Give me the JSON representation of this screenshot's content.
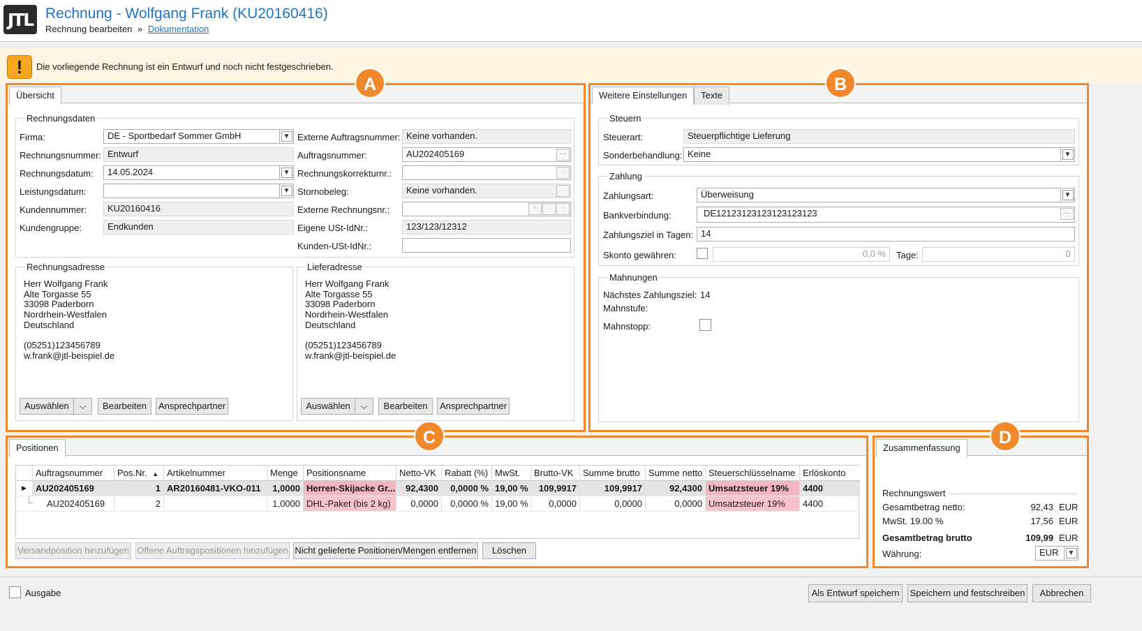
{
  "header": {
    "logo": "JTL",
    "title": "Rechnung - Wolfgang Frank (KU20160416)",
    "breadcrumb_current": "Rechnung bearbeiten",
    "breadcrumb_sep": "»",
    "breadcrumb_link": "Dokumentation"
  },
  "warning": {
    "icon": "!",
    "text": "Die vorliegende Rechnung ist ein Entwurf und noch nicht festgeschrieben."
  },
  "badges": {
    "a": "A",
    "b": "B",
    "c": "C",
    "d": "D"
  },
  "overview": {
    "tab": "Übersicht",
    "group_title": "Rechnungsdaten",
    "left": [
      {
        "label": "Firma:",
        "value": "DE - Sportbedarf Sommer GmbH"
      },
      {
        "label": "Rechnungsnummer:",
        "value": "Entwurf"
      },
      {
        "label": "Rechnungsdatum:",
        "value": "14.05.2024"
      },
      {
        "label": "Leistungsdatum:",
        "value": ""
      },
      {
        "label": "Kundennummer:",
        "value": "KU20160416"
      },
      {
        "label": "Kundengruppe:",
        "value": "Endkunden"
      }
    ],
    "right": [
      {
        "label": "Externe Auftragsnummer:",
        "value": "Keine vorhanden."
      },
      {
        "label": "Auftragsnummer:",
        "value": "AU202405169"
      },
      {
        "label": "Rechnungskorrekturnr.:",
        "value": ""
      },
      {
        "label": "Stornobeleg:",
        "value": "Keine vorhanden."
      },
      {
        "label": "Externe Rechnungsnr.:",
        "value": ""
      },
      {
        "label": "Eigene USt-IdNr.:",
        "value": "123/123/12312"
      },
      {
        "label": "Kunden-USt-IdNr.:",
        "value": ""
      }
    ],
    "ellipsis": "···",
    "plus": "+",
    "minus": "−",
    "billing": {
      "title": "Rechnungsadresse",
      "lines": [
        "Herr Wolfgang Frank",
        "Alte Torgasse 55",
        "33098 Paderborn",
        "Nordrhein-Westfalen",
        "Deutschland"
      ],
      "phone": "(05251)123456789",
      "email": "w.frank@jtl-beispiel.de"
    },
    "shipping": {
      "title": "Lieferadresse",
      "lines": [
        "Herr Wolfgang Frank",
        "Alte Torgasse 55",
        "33098 Paderborn",
        "Nordrhein-Westfalen",
        "Deutschland"
      ],
      "phone": "(05251)123456789",
      "email": "w.frank@jtl-beispiel.de"
    },
    "buttons": {
      "select": "Auswählen",
      "edit": "Bearbeiten",
      "contact": "Ansprechpartner"
    }
  },
  "settings": {
    "tabs": [
      "Weitere Einstellungen",
      "Texte"
    ],
    "taxes": {
      "title": "Steuern",
      "tax_type_label": "Steuerart:",
      "tax_type": "Steuerpflichtige Lieferung",
      "special_label": "Sonderbehandlung:",
      "special": "Keine"
    },
    "payment": {
      "title": "Zahlung",
      "method_label": "Zahlungsart:",
      "method": "Überweisung",
      "bank_label": "Bankverbindung:",
      "bank": "DE12123123123123123123",
      "term_label": "Zahlungsziel in Tagen:",
      "term": "14",
      "discount_label": "Skonto gewähren:",
      "discount_value": "0,0 %",
      "days_label": "Tage:",
      "days_value": "0"
    },
    "dunning": {
      "title": "Mahnungen",
      "next_label": "Nächstes Zahlungsziel:",
      "next_value": "14",
      "level_label": "Mahnstufe:",
      "stop_label": "Mahnstopp:"
    }
  },
  "positions": {
    "tab": "Positionen",
    "columns": [
      "Auftragsnummer",
      "Pos.Nr.",
      "Artikelnummer",
      "Menge",
      "Positionsname",
      "Netto-VK",
      "Rabatt (%)",
      "MwSt.",
      "Brutto-VK",
      "Summe brutto",
      "Summe netto",
      "Steuerschlüsselname",
      "Erlöskonto"
    ],
    "rows": [
      [
        "AU202405169",
        "1",
        "AR20160481-VKO-011",
        "1,0000",
        "Herren-Skijacke Gr...",
        "92,4300",
        "0,0000 %",
        "19,00 %",
        "109,9917",
        "109,9917",
        "92,4300",
        "Umsatzsteuer 19%",
        "4400"
      ],
      [
        "AU202405169",
        "2",
        "",
        "1,0000",
        "DHL-Paket (bis 2 kg)",
        "0,0000",
        "0,0000 %",
        "19,00 %",
        "0,0000",
        "0,0000",
        "0,0000",
        "Umsatzsteuer 19%",
        "4400"
      ]
    ],
    "buttons": {
      "add_shipping": "Versandposition hinzufügen",
      "add_open": "Offene Auftragspositionen hinzufügen",
      "remove_undelivered": "Nicht gelieferte Positionen/Mengen entfernen",
      "delete": "Löschen"
    }
  },
  "summary": {
    "tab": "Zusammenfassung",
    "group_title": "Rechnungswert",
    "net_label": "Gesamtbetrag netto:",
    "net_value": "92,43",
    "net_cur": "EUR",
    "vat_label": "MwSt. 19.00 %",
    "vat_value": "17,56",
    "vat_cur": "EUR",
    "gross_label": "Gesamtbetrag brutto",
    "gross_value": "109,99",
    "gross_cur": "EUR",
    "currency_label": "Währung:",
    "currency": "EUR"
  },
  "footer": {
    "output_label": "Ausgabe",
    "save_draft": "Als Entwurf speichern",
    "save_finalize": "Speichern und festschreiben",
    "cancel": "Abbrechen"
  },
  "colors": {
    "accent": "#f0892c",
    "link": "#1d74c4",
    "warning_bg": "#fdf5e1",
    "pink": "#f7c4cd"
  }
}
